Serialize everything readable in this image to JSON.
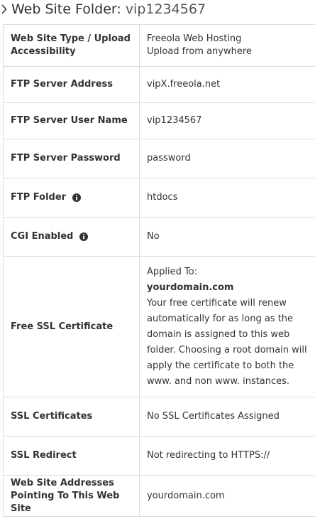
{
  "header": {
    "icon": "chevron-right-icon",
    "title_prefix": "Web Site Folder:",
    "title_value": "vip1234567"
  },
  "rows": [
    {
      "label": "Web Site Type / Upload Accessibility",
      "value_lines": [
        "Freeola Web Hosting",
        "Upload from anywhere"
      ]
    },
    {
      "label": "FTP Server Address",
      "value": "vipX.freeola.net"
    },
    {
      "label": "FTP Server User Name",
      "value": "vip1234567"
    },
    {
      "label": "FTP Server Password",
      "value": "password"
    },
    {
      "label": "FTP Folder",
      "icon": "info-icon",
      "value": "htdocs"
    },
    {
      "label": "CGI Enabled",
      "icon": "info-icon",
      "value": "No"
    },
    {
      "label": "Free SSL Certificate",
      "ssl": {
        "applied_to_label": "Applied To:",
        "domain": "yourdomain.com",
        "description": "Your free certificate will renew automatically for as long as the domain is assigned to this web folder. Choosing a root domain will apply the certificate to both the www. and non www. instances."
      }
    },
    {
      "label": "SSL Certificates",
      "value": "No SSL Certificates Assigned"
    },
    {
      "label": "SSL Redirect",
      "value": "Not redirecting to HTTPS://"
    },
    {
      "label": "Web Site Addresses Pointing To This Web Site",
      "value": "yourdomain.com"
    }
  ]
}
